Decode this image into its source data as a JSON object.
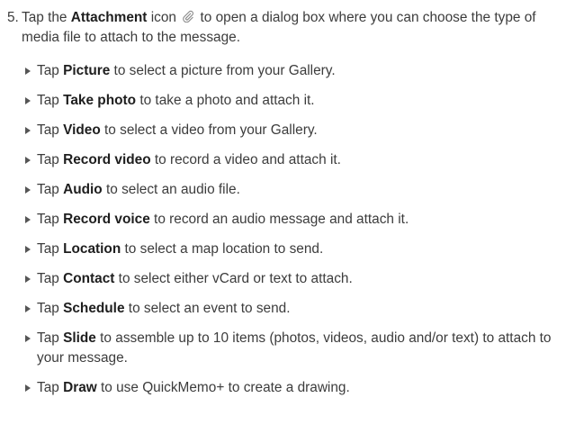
{
  "step": {
    "number": "5.",
    "text_before": "Tap the ",
    "bold": "Attachment",
    "text_after": " icon ",
    "text_end": " to open a dialog box where you can choose the type of media file to attach to the message.",
    "icon": "paperclip-icon"
  },
  "items": [
    {
      "pre": "Tap ",
      "bold": "Picture",
      "post": " to select a picture from your Gallery."
    },
    {
      "pre": "Tap ",
      "bold": "Take photo",
      "post": " to take a photo and attach it."
    },
    {
      "pre": "Tap ",
      "bold": "Video",
      "post": " to select a video from your Gallery."
    },
    {
      "pre": "Tap ",
      "bold": "Record video",
      "post": " to record a video and attach it."
    },
    {
      "pre": "Tap ",
      "bold": "Audio",
      "post": " to select an audio file."
    },
    {
      "pre": "Tap ",
      "bold": "Record voice",
      "post": " to record an audio message and attach it."
    },
    {
      "pre": "Tap ",
      "bold": "Location",
      "post": " to select a map location to send."
    },
    {
      "pre": "Tap ",
      "bold": "Contact",
      "post": " to select either vCard or text to attach."
    },
    {
      "pre": "Tap ",
      "bold": "Schedule",
      "post": " to select an event to send."
    },
    {
      "pre": "Tap ",
      "bold": "Slide",
      "post": " to assemble up to 10 items (photos, videos, audio and/or text) to attach to your message."
    },
    {
      "pre": "Tap ",
      "bold": "Draw",
      "post": " to use QuickMemo+ to create a drawing."
    }
  ]
}
